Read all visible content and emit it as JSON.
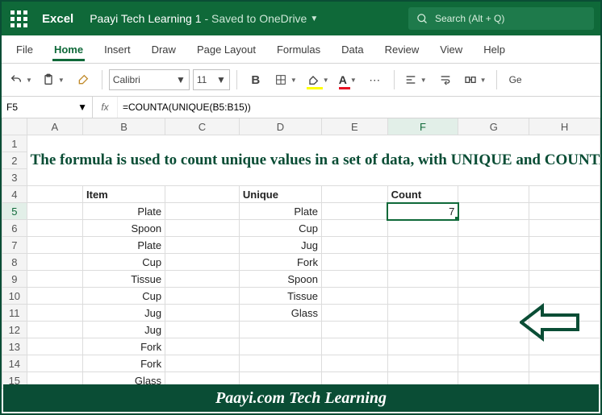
{
  "titlebar": {
    "app_name": "Excel",
    "doc_title": "Paayi Tech Learning 1",
    "save_status": "- Saved to OneDrive",
    "search_placeholder": "Search (Alt + Q)"
  },
  "tabs": {
    "items": [
      "File",
      "Home",
      "Insert",
      "Draw",
      "Page Layout",
      "Formulas",
      "Data",
      "Review",
      "View",
      "Help"
    ],
    "active_index": 1
  },
  "ribbon": {
    "font_name": "Calibri",
    "font_size": "11",
    "extra_label": "Ge"
  },
  "formula": {
    "cell_ref": "F5",
    "fx_label": "fx",
    "text": "=COUNTA(UNIQUE(B5:B15))"
  },
  "columns": [
    "A",
    "B",
    "C",
    "D",
    "E",
    "F",
    "G",
    "H"
  ],
  "active_col_index": 5,
  "active_row": 5,
  "headline": "The formula is used to count unique values in a set of data, with UNIQUE and COUNTA function.",
  "sheet": {
    "headers": {
      "item": "Item",
      "unique": "Unique",
      "count": "Count"
    },
    "items": [
      "Plate",
      "Spoon",
      "Plate",
      "Cup",
      "Tissue",
      "Cup",
      "Jug",
      "Jug",
      "Fork",
      "Fork",
      "Glass"
    ],
    "unique": [
      "Plate",
      "Cup",
      "Jug",
      "Fork",
      "Spoon",
      "Tissue",
      "Glass"
    ],
    "count_value": "7"
  },
  "footer": "Paayi.com Tech Learning"
}
